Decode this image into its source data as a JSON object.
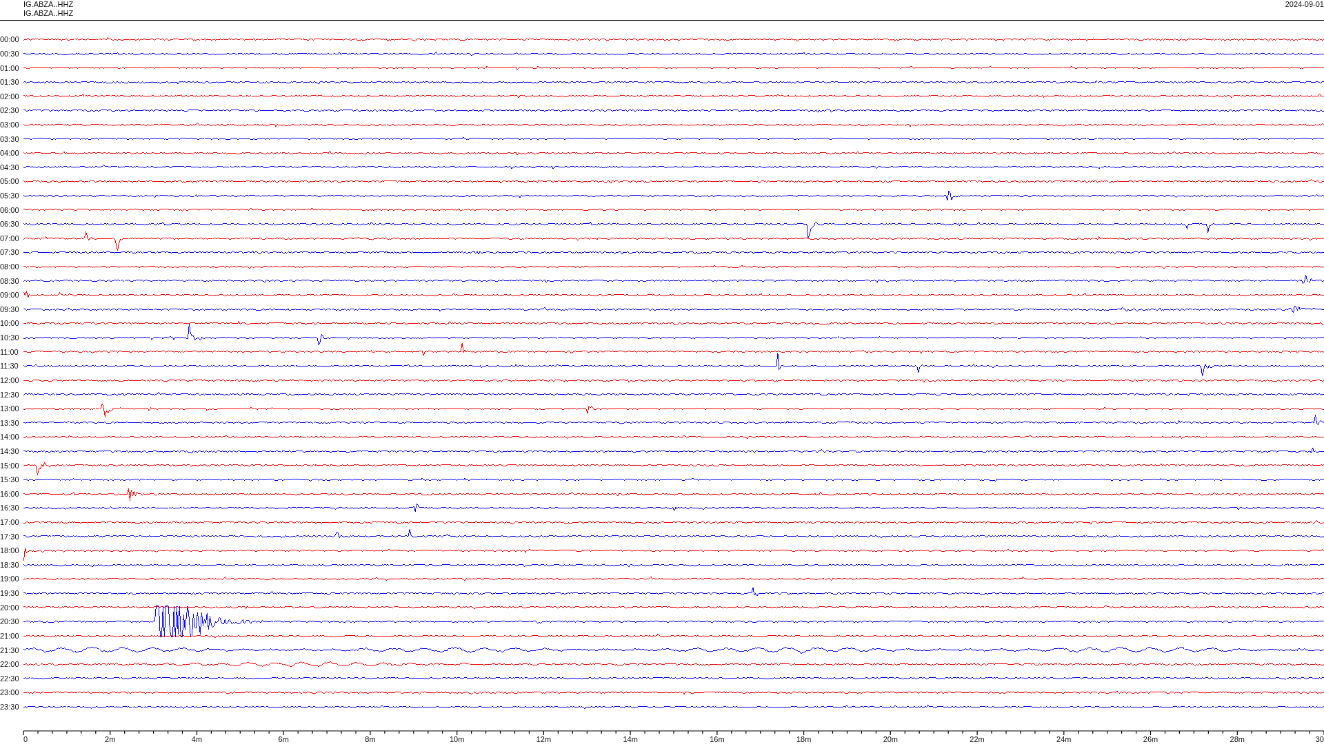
{
  "header": {
    "station_lines": [
      "IG.ABZA..HHZ",
      "IG.ABZA..HHZ"
    ],
    "date": "2024-09-01"
  },
  "rows": [
    {
      "time": "00:00",
      "color": "#ff0000"
    },
    {
      "time": "00:30",
      "color": "#0000ff"
    },
    {
      "time": "01:00",
      "color": "#ff0000"
    },
    {
      "time": "01:30",
      "color": "#0000ff"
    },
    {
      "time": "02:00",
      "color": "#ff0000"
    },
    {
      "time": "02:30",
      "color": "#0000ff"
    },
    {
      "time": "03:00",
      "color": "#ff0000"
    },
    {
      "time": "03:30",
      "color": "#0000ff"
    },
    {
      "time": "04:00",
      "color": "#ff0000"
    },
    {
      "time": "04:30",
      "color": "#0000ff"
    },
    {
      "time": "05:00",
      "color": "#ff0000"
    },
    {
      "time": "05:30",
      "color": "#0000ff"
    },
    {
      "time": "06:00",
      "color": "#ff0000"
    },
    {
      "time": "06:30",
      "color": "#0000ff"
    },
    {
      "time": "07:00",
      "color": "#ff0000"
    },
    {
      "time": "07:30",
      "color": "#0000ff"
    },
    {
      "time": "08:00",
      "color": "#ff0000"
    },
    {
      "time": "08:30",
      "color": "#0000ff"
    },
    {
      "time": "09:00",
      "color": "#ff0000"
    },
    {
      "time": "09:30",
      "color": "#0000ff"
    },
    {
      "time": "10:00",
      "color": "#ff0000"
    },
    {
      "time": "10:30",
      "color": "#0000ff"
    },
    {
      "time": "11:00",
      "color": "#ff0000"
    },
    {
      "time": "11:30",
      "color": "#0000ff"
    },
    {
      "time": "12:00",
      "color": "#ff0000"
    },
    {
      "time": "12:30",
      "color": "#0000ff"
    },
    {
      "time": "13:00",
      "color": "#ff0000"
    },
    {
      "time": "13:30",
      "color": "#0000ff"
    },
    {
      "time": "14:00",
      "color": "#ff0000"
    },
    {
      "time": "14:30",
      "color": "#0000ff"
    },
    {
      "time": "15:00",
      "color": "#ff0000"
    },
    {
      "time": "15:30",
      "color": "#0000ff"
    },
    {
      "time": "16:00",
      "color": "#ff0000"
    },
    {
      "time": "16:30",
      "color": "#0000ff"
    },
    {
      "time": "17:00",
      "color": "#ff0000"
    },
    {
      "time": "17:30",
      "color": "#0000ff"
    },
    {
      "time": "18:00",
      "color": "#ff0000"
    },
    {
      "time": "18:30",
      "color": "#0000ff"
    },
    {
      "time": "19:00",
      "color": "#ff0000"
    },
    {
      "time": "19:30",
      "color": "#0000ff"
    },
    {
      "time": "20:00",
      "color": "#ff0000"
    },
    {
      "time": "20:30",
      "color": "#0000ff"
    },
    {
      "time": "21:00",
      "color": "#ff0000"
    },
    {
      "time": "21:30",
      "color": "#0000ff"
    },
    {
      "time": "22:00",
      "color": "#ff0000"
    },
    {
      "time": "22:30",
      "color": "#0000ff"
    },
    {
      "time": "23:00",
      "color": "#ff0000"
    },
    {
      "time": "23:30",
      "color": "#0000ff"
    }
  ],
  "time_axis": {
    "ticks": [
      "0",
      "2m",
      "4m",
      "6m",
      "8m",
      "10m",
      "12m",
      "14m",
      "16m",
      "18m",
      "20m",
      "22m",
      "24m",
      "26m",
      "28m",
      "30"
    ]
  }
}
